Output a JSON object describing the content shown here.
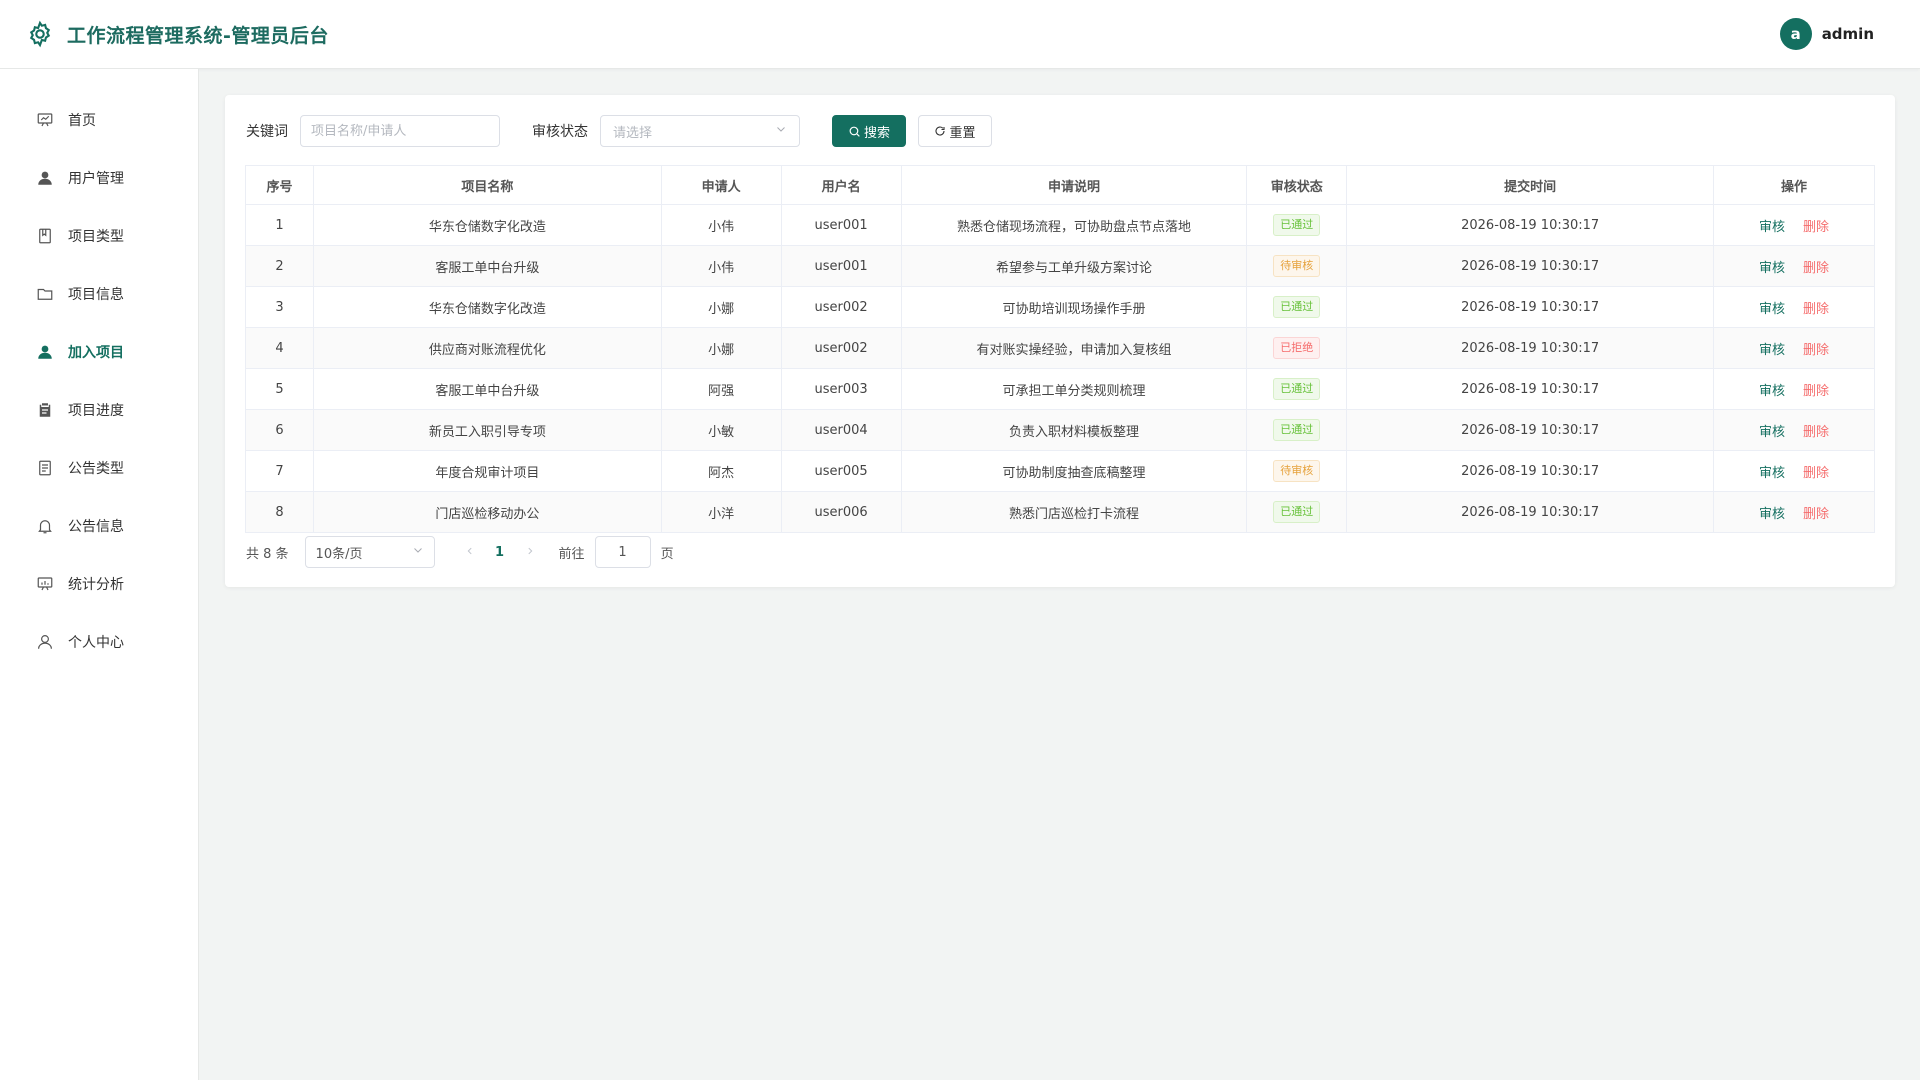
{
  "header": {
    "title": "工作流程管理系统-管理员后台",
    "avatar_letter": "a",
    "username": "admin",
    "accent": "#146f60"
  },
  "sidebar": {
    "items": [
      {
        "label": "首页",
        "icon": "home-chart-icon"
      },
      {
        "label": "用户管理",
        "icon": "user-filled-icon"
      },
      {
        "label": "项目类型",
        "icon": "notebook-icon"
      },
      {
        "label": "项目信息",
        "icon": "folder-icon"
      },
      {
        "label": "加入项目",
        "icon": "user-filled-icon",
        "active": true
      },
      {
        "label": "项目进度",
        "icon": "clipboard-icon"
      },
      {
        "label": "公告类型",
        "icon": "document-icon"
      },
      {
        "label": "公告信息",
        "icon": "bell-icon"
      },
      {
        "label": "统计分析",
        "icon": "data-board-icon"
      },
      {
        "label": "个人中心",
        "icon": "user-outline-icon"
      }
    ]
  },
  "filters": {
    "keyword_label": "关键词",
    "keyword_placeholder": "项目名称/申请人",
    "keyword_value": "",
    "status_label": "审核状态",
    "status_placeholder": "请选择",
    "search_label": "搜索",
    "reset_label": "重置"
  },
  "table": {
    "columns": [
      "序号",
      "项目名称",
      "申请人",
      "用户名",
      "申请说明",
      "审核状态",
      "提交时间",
      "操作"
    ],
    "rows": [
      {
        "no": "1",
        "project": "华东仓储数字化改造",
        "applicant": "小伟",
        "username": "user001",
        "note": "熟悉仓储现场流程，可协助盘点节点落地",
        "status": "已通过",
        "status_type": "ok",
        "time": "2026-08-19 10:30:17"
      },
      {
        "no": "2",
        "project": "客服工单中台升级",
        "applicant": "小伟",
        "username": "user001",
        "note": "希望参与工单升级方案讨论",
        "status": "待审核",
        "status_type": "wait",
        "time": "2026-08-19 10:30:17"
      },
      {
        "no": "3",
        "project": "华东仓储数字化改造",
        "applicant": "小娜",
        "username": "user002",
        "note": "可协助培训现场操作手册",
        "status": "已通过",
        "status_type": "ok",
        "time": "2026-08-19 10:30:17"
      },
      {
        "no": "4",
        "project": "供应商对账流程优化",
        "applicant": "小娜",
        "username": "user002",
        "note": "有对账实操经验，申请加入复核组",
        "status": "已拒绝",
        "status_type": "rej",
        "time": "2026-08-19 10:30:17"
      },
      {
        "no": "5",
        "project": "客服工单中台升级",
        "applicant": "阿强",
        "username": "user003",
        "note": "可承担工单分类规则梳理",
        "status": "已通过",
        "status_type": "ok",
        "time": "2026-08-19 10:30:17"
      },
      {
        "no": "6",
        "project": "新员工入职引导专项",
        "applicant": "小敏",
        "username": "user004",
        "note": "负责入职材料模板整理",
        "status": "已通过",
        "status_type": "ok",
        "time": "2026-08-19 10:30:17"
      },
      {
        "no": "7",
        "project": "年度合规审计项目",
        "applicant": "阿杰",
        "username": "user005",
        "note": "可协助制度抽查底稿整理",
        "status": "待审核",
        "status_type": "wait",
        "time": "2026-08-19 10:30:17"
      },
      {
        "no": "8",
        "project": "门店巡检移动办公",
        "applicant": "小洋",
        "username": "user006",
        "note": "熟悉门店巡检打卡流程",
        "status": "已通过",
        "status_type": "ok",
        "time": "2026-08-19 10:30:17"
      }
    ],
    "action_audit": "审核",
    "action_delete": "删除"
  },
  "pager": {
    "total_text": "共 8 条",
    "page_size": "10条/页",
    "current_page": "1",
    "goto_label": "前往",
    "goto_value": "1",
    "goto_unit": "页"
  }
}
